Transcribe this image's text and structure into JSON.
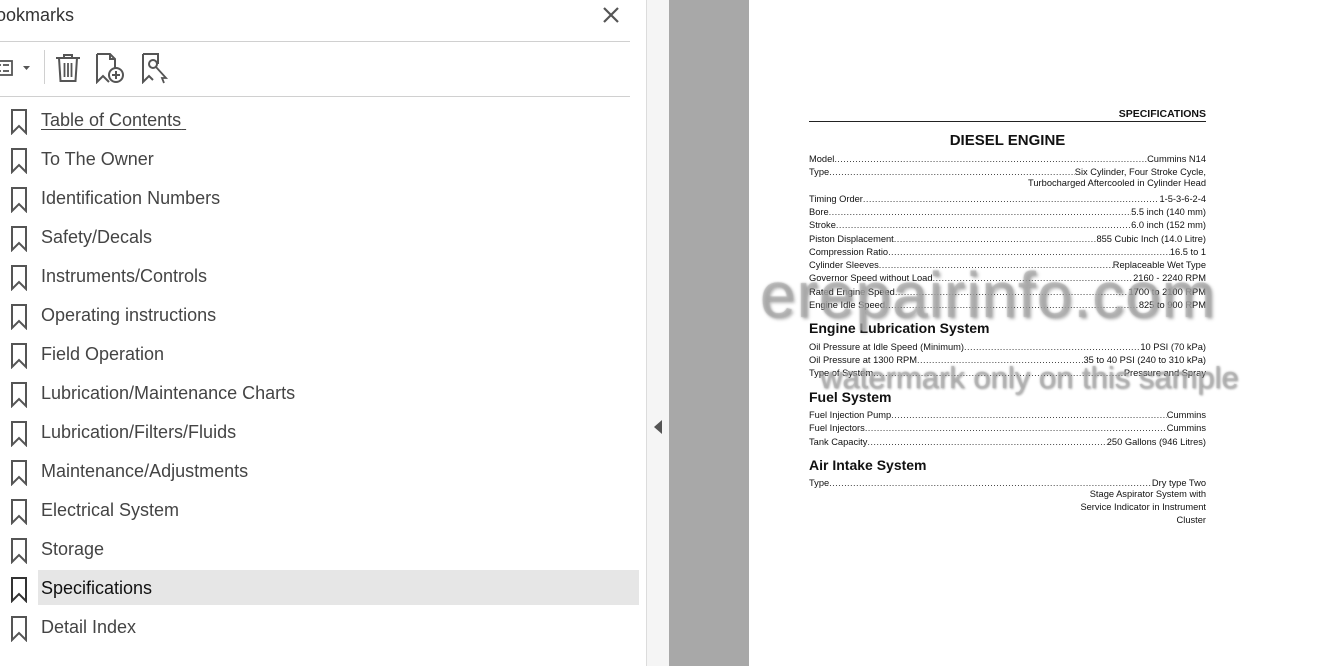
{
  "panel": {
    "title": "ookmarks",
    "close_icon": "close-icon",
    "toolbar": {
      "options_icon": "list-options-icon",
      "delete_icon": "trash-icon",
      "new_bookmark_icon": "new-bookmark-icon",
      "find_bookmark_icon": "find-bookmark-icon"
    },
    "bookmarks": [
      {
        "label": "Table of Contents"
      },
      {
        "label": "To The Owner"
      },
      {
        "label": "Identification Numbers"
      },
      {
        "label": "Safety/Decals"
      },
      {
        "label": "Instruments/Controls"
      },
      {
        "label": "Operating instructions"
      },
      {
        "label": "Field Operation"
      },
      {
        "label": "Lubrication/Maintenance Charts"
      },
      {
        "label": "Lubrication/Filters/Fluids"
      },
      {
        "label": "Maintenance/Adjustments"
      },
      {
        "label": "Electrical System"
      },
      {
        "label": "Storage"
      },
      {
        "label": "Specifications"
      },
      {
        "label": "Detail Index"
      }
    ],
    "selected_bookmark": "Specifications"
  },
  "document": {
    "section": "SPECIFICATIONS",
    "engine_title": "DIESEL ENGINE",
    "engine": [
      {
        "label": "Model",
        "value": "Cummins N14"
      },
      {
        "label": "Type",
        "value": "Six Cylinder, Four Stroke Cycle,"
      },
      {
        "label": "Timing Order",
        "value": "1-5-3-6-2-4"
      },
      {
        "label": "Bore",
        "value": "5.5 inch (140 mm)"
      },
      {
        "label": "Stroke",
        "value": "6.0 inch (152 mm)"
      },
      {
        "label": "Piston Displacement ",
        "value": "855 Cubic Inch (14.0 Litre)"
      },
      {
        "label": "Compression Ratio",
        "value": "16.5 to 1"
      },
      {
        "label": "Cylinder Sleeves",
        "value": "Replaceable Wet Type"
      },
      {
        "label": "Governor Speed without Load",
        "value": "2160 - 2240 RPM"
      },
      {
        "label": "Rated Engine Speed",
        "value": "1700 to 2100 RPM"
      },
      {
        "label": "Engine Idle Speed",
        "value": "825 to 900 RPM"
      }
    ],
    "engine_type_cont": "Turbocharged Aftercooled in Cylinder Head",
    "lube_title": "Engine Lubrication System",
    "lube": [
      {
        "label": "Oil Pressure at Idle Speed (Minimum) ",
        "value": "10 PSI (70 kPa)"
      },
      {
        "label": "Oil Pressure at 1300 RPM",
        "value": "35 to 40 PSI (240 to 310 kPa)"
      },
      {
        "label": "Type of System",
        "value": "Pressure and Spray"
      }
    ],
    "fuel_title": "Fuel System",
    "fuel": [
      {
        "label": "Fuel Injection Pump ",
        "value": "Cummins"
      },
      {
        "label": "Fuel Injectors",
        "value": "Cummins"
      },
      {
        "label": "Tank Capacity ",
        "value": "250 Gallons (946 Litres)"
      }
    ],
    "air_title": "Air Intake System",
    "air": [
      {
        "label": "Type",
        "value": "Dry type Two"
      }
    ],
    "air_cont": [
      "Stage Aspirator System with",
      "Service Indicator in Instrument",
      "Cluster"
    ],
    "watermark_main": "erepairinfo.com",
    "watermark_sub": "watermark only on this sample"
  }
}
